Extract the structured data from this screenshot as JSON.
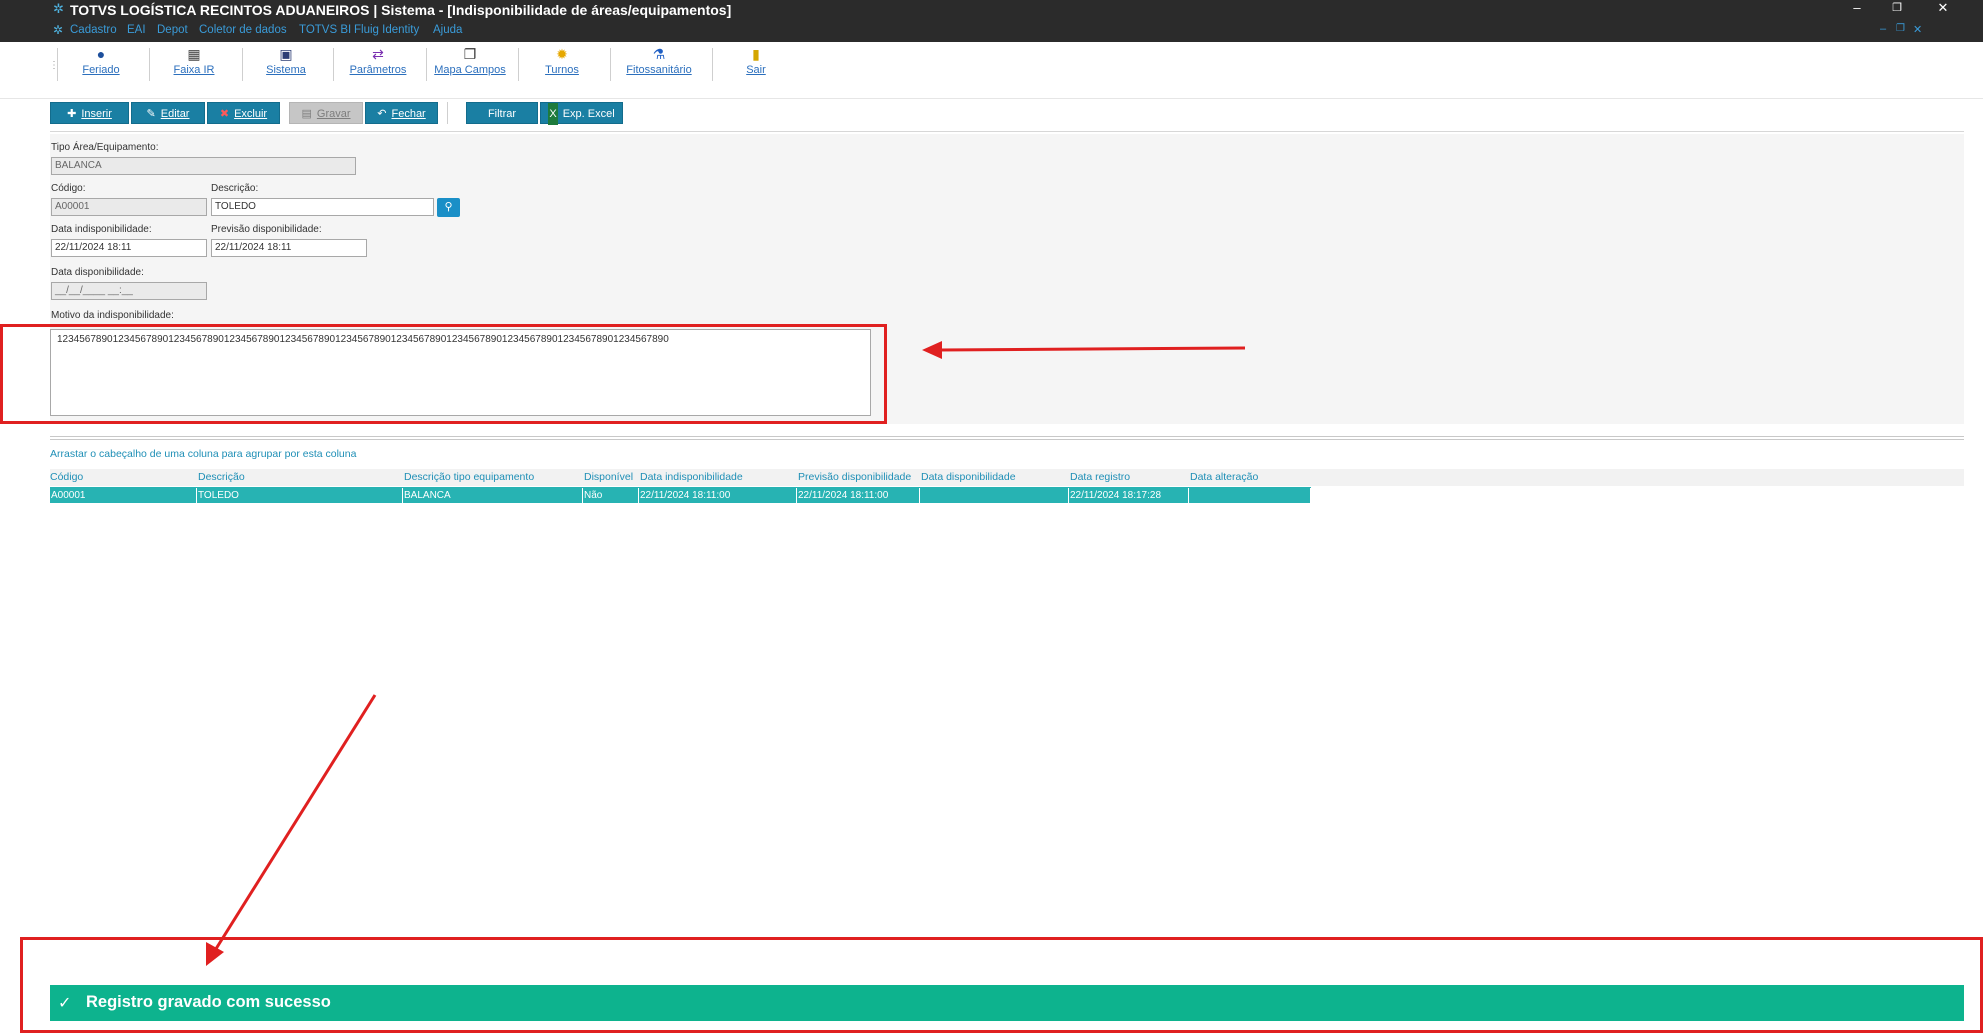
{
  "window": {
    "title": "TOTVS LOGÍSTICA RECINTOS ADUANEIROS | Sistema - [Indisponibilidade de áreas/equipamentos]",
    "app_icon": "gear-icon",
    "controls": {
      "minimize": "–",
      "restore": "❐",
      "close": "✕"
    },
    "sub_controls": {
      "minimize": "–",
      "restore": "❐",
      "close": "✕"
    }
  },
  "menu": {
    "items": [
      "Cadastro",
      "EAI",
      "Depot",
      "Coletor de dados",
      "TOTVS BI",
      "Fluig Identity",
      "Ajuda"
    ]
  },
  "toolbar": {
    "items": [
      {
        "label": "Feriado",
        "icon": "globe-icon"
      },
      {
        "label": "Faixa IR",
        "icon": "calculator-icon"
      },
      {
        "label": "Sistema",
        "icon": "monitor-icon"
      },
      {
        "label": "Parâmetros",
        "icon": "sliders-icon"
      },
      {
        "label": "Mapa Campos",
        "icon": "documents-icon"
      },
      {
        "label": "Turnos",
        "icon": "sun-icon"
      },
      {
        "label": "Fitossanitário",
        "icon": "flask-icon"
      },
      {
        "label": "Sair",
        "icon": "exit-door-icon"
      }
    ]
  },
  "actions": {
    "inserir": "Inserir",
    "editar": "Editar",
    "excluir": "Excluir",
    "gravar": "Gravar",
    "fechar": "Fechar",
    "filtrar": "Filtrar",
    "exp_excel": "Exp. Excel"
  },
  "form": {
    "tipo_label": "Tipo Área/Equipamento:",
    "tipo_value": "BALANCA",
    "codigo_label": "Código:",
    "codigo_value": "A00001",
    "descricao_label": "Descrição:",
    "descricao_value": "TOLEDO",
    "data_indisp_label": "Data indisponibilidade:",
    "data_indisp_value": "22/11/2024 18:11",
    "prev_disp_label": "Previsão disponibilidade:",
    "prev_disp_value": "22/11/2024 18:11",
    "data_disp_label": "Data disponibilidade:",
    "data_disp_value": "__/__/____ __:__",
    "motivo_label": "Motivo da indisponibilidade:",
    "motivo_value": "12345678901234567890123456789012345678901234567890123456789012345678901234567890123456789012345678901234567890"
  },
  "grid": {
    "group_hint": "Arrastar o cabeçalho de uma coluna para agrupar por esta coluna",
    "columns": [
      "Código",
      "Descrição",
      "Descrição tipo equipamento",
      "Disponível",
      "Data indisponibilidade",
      "Previsão disponibilidade",
      "Data disponibilidade",
      "Data registro",
      "Data alteração"
    ],
    "rows": [
      [
        "A00001",
        "TOLEDO",
        "BALANCA",
        "Não",
        "22/11/2024 18:11:00",
        "22/11/2024 18:11:00",
        "",
        "22/11/2024 18:17:28",
        ""
      ]
    ]
  },
  "toast": {
    "icon": "check-icon",
    "message": "Registro gravado com sucesso"
  },
  "colors": {
    "titlebar": "#2b2b2b",
    "button": "#1a7fa3",
    "selected_row": "#27b3b3",
    "toast": "#0db38e",
    "annotation": "#e02020"
  }
}
